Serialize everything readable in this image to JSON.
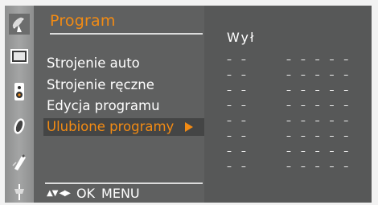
{
  "menu": {
    "title": "Program",
    "items": [
      {
        "label": "Strojenie auto",
        "active": false
      },
      {
        "label": "Strojenie ręczne",
        "active": false
      },
      {
        "label": "Edycja programu",
        "active": false
      },
      {
        "label": "Ulubione programy",
        "active": true
      }
    ],
    "hints": {
      "nav_arrows": "▲▼ ◀▶",
      "ok": "OK",
      "menu": "MENU"
    }
  },
  "favorites": {
    "status": "Wył",
    "slots": [
      {
        "num": "– –",
        "name": "– – – – –"
      },
      {
        "num": "– –",
        "name": "– – – – –"
      },
      {
        "num": "– –",
        "name": "– – – – –"
      },
      {
        "num": "– –",
        "name": "– – – – –"
      },
      {
        "num": "– –",
        "name": "– – – – –"
      },
      {
        "num": "– –",
        "name": "– – – – –"
      },
      {
        "num": "– –",
        "name": "– – – – –"
      },
      {
        "num": "– –",
        "name": "– – – – –"
      }
    ]
  },
  "sidebar_icons": [
    "satellite-dish-icon",
    "picture-icon",
    "audio-icon",
    "time-clock-icon",
    "option-tag-icon",
    "input-plug-icon"
  ],
  "colors": {
    "accent": "#f28b14",
    "menu_bg": "#5f6060",
    "panel_bg": "#575858",
    "selected_bg": "#444545",
    "icon_bar": "#9a9b9b"
  }
}
